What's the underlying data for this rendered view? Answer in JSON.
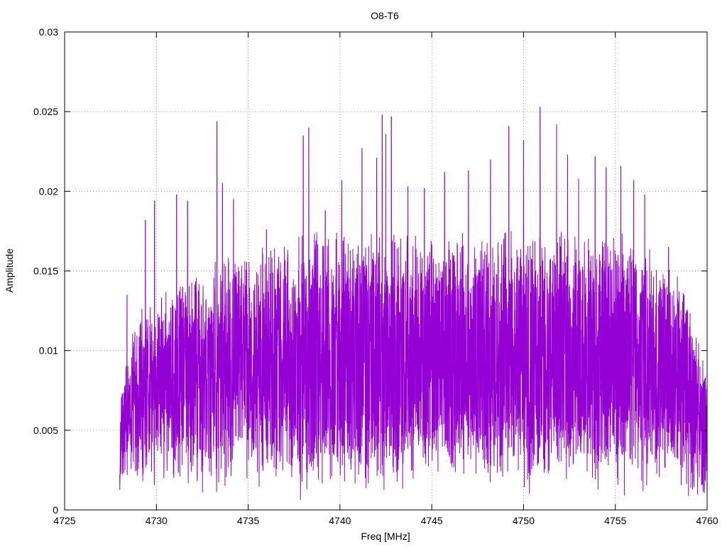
{
  "chart_data": {
    "type": "line",
    "title": "O8-T6",
    "xlabel": "Freq [MHz]",
    "ylabel": "Amplitude",
    "xlim": [
      4725,
      4760
    ],
    "ylim": [
      0,
      0.03
    ],
    "x_ticks": [
      4725,
      4730,
      4735,
      4740,
      4745,
      4750,
      4755,
      4760
    ],
    "x_tick_labels": [
      "4725",
      "4730",
      "4735",
      "4740",
      "4745",
      "4750",
      "4755",
      "4760"
    ],
    "y_ticks": [
      0,
      0.005,
      0.01,
      0.015,
      0.02,
      0.025,
      0.03
    ],
    "y_tick_labels": [
      "0",
      "0.005",
      "0.01",
      "0.015",
      "0.02",
      "0.025",
      "0.03"
    ],
    "grid": true,
    "legend": "none",
    "series": [
      {
        "color": "#9400d3",
        "x_start": 4728.0,
        "x_end": 4760.0,
        "envelope_x": [
          4728.0,
          4728.1,
          4728.5,
          4729,
          4730,
          4731,
          4733,
          4735,
          4737,
          4740,
          4742,
          4745,
          4748,
          4750,
          4752,
          4755,
          4757,
          4758,
          4759,
          4760
        ],
        "envelope_low": [
          0.001,
          0.003,
          0.004,
          0.004,
          0.004,
          0.004,
          0.004,
          0.004,
          0.004,
          0.004,
          0.004,
          0.004,
          0.004,
          0.004,
          0.004,
          0.004,
          0.004,
          0.004,
          0.003,
          0.001
        ],
        "envelope_high": [
          0.004,
          0.008,
          0.01,
          0.011,
          0.012,
          0.013,
          0.014,
          0.015,
          0.016,
          0.016,
          0.016,
          0.016,
          0.016,
          0.016,
          0.016,
          0.016,
          0.015,
          0.014,
          0.012,
          0.008
        ],
        "peaks": [
          {
            "x": 4728.4,
            "y": 0.0135
          },
          {
            "x": 4729.4,
            "y": 0.0182
          },
          {
            "x": 4729.9,
            "y": 0.0194
          },
          {
            "x": 4731.1,
            "y": 0.0198
          },
          {
            "x": 4731.7,
            "y": 0.0194
          },
          {
            "x": 4733.3,
            "y": 0.0244
          },
          {
            "x": 4733.6,
            "y": 0.0205
          },
          {
            "x": 4734.2,
            "y": 0.0195
          },
          {
            "x": 4736.0,
            "y": 0.0176
          },
          {
            "x": 4738.0,
            "y": 0.0235
          },
          {
            "x": 4738.3,
            "y": 0.024
          },
          {
            "x": 4739.2,
            "y": 0.0188
          },
          {
            "x": 4740.1,
            "y": 0.0207
          },
          {
            "x": 4741.2,
            "y": 0.0227
          },
          {
            "x": 4742.0,
            "y": 0.0221
          },
          {
            "x": 4742.3,
            "y": 0.0248
          },
          {
            "x": 4742.5,
            "y": 0.0236
          },
          {
            "x": 4742.8,
            "y": 0.0247
          },
          {
            "x": 4743.7,
            "y": 0.0203
          },
          {
            "x": 4744.6,
            "y": 0.0202
          },
          {
            "x": 4745.7,
            "y": 0.0212
          },
          {
            "x": 4747.0,
            "y": 0.0213
          },
          {
            "x": 4748.2,
            "y": 0.022
          },
          {
            "x": 4749.2,
            "y": 0.0241
          },
          {
            "x": 4750.0,
            "y": 0.0232
          },
          {
            "x": 4750.9,
            "y": 0.0253
          },
          {
            "x": 4751.8,
            "y": 0.0242
          },
          {
            "x": 4752.4,
            "y": 0.0223
          },
          {
            "x": 4753.0,
            "y": 0.0208
          },
          {
            "x": 4753.9,
            "y": 0.0222
          },
          {
            "x": 4754.5,
            "y": 0.0215
          },
          {
            "x": 4755.3,
            "y": 0.0216
          },
          {
            "x": 4756.0,
            "y": 0.0207
          },
          {
            "x": 4756.6,
            "y": 0.0198
          },
          {
            "x": 4757.9,
            "y": 0.0165
          },
          {
            "x": 4758.7,
            "y": 0.0136
          },
          {
            "x": 4759.4,
            "y": 0.0108
          },
          {
            "x": 4759.9,
            "y": 0.0083
          }
        ]
      }
    ]
  }
}
